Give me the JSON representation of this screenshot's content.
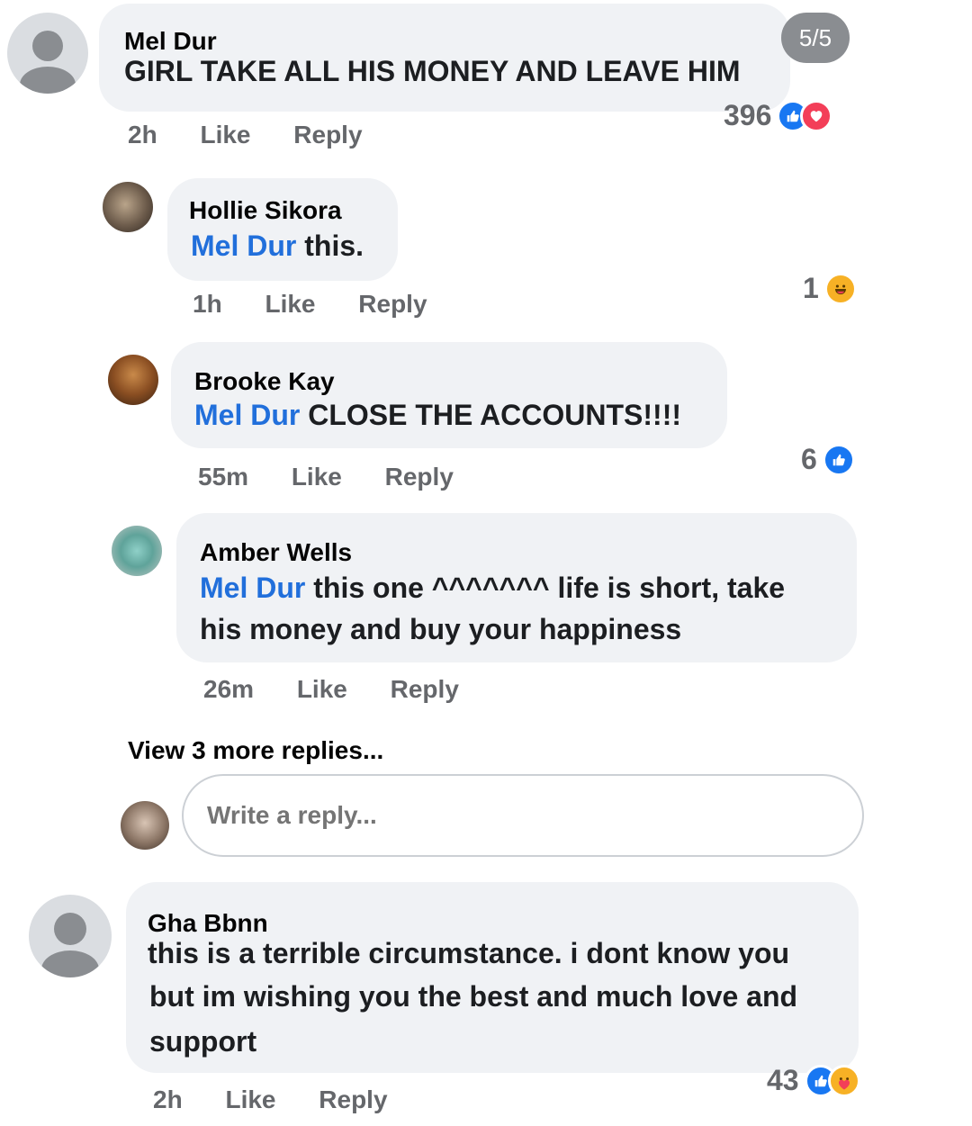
{
  "pager": "5/5",
  "comments": [
    {
      "author": "Mel Dur",
      "text": "GIRL TAKE ALL HIS MONEY AND LEAVE HIM",
      "time": "2h",
      "like": "Like",
      "reply": "Reply",
      "reactions_count": "396",
      "reactions": [
        "like-icon",
        "love-icon"
      ]
    },
    {
      "author": "Hollie Sikora",
      "mention": "Mel Dur",
      "text": " this.",
      "time": "1h",
      "like": "Like",
      "reply": "Reply",
      "reactions_count": "1",
      "reactions": [
        "haha-icon"
      ]
    },
    {
      "author": "Brooke Kay",
      "mention": "Mel Dur",
      "text": " CLOSE THE ACCOUNTS!!!!",
      "time": "55m",
      "like": "Like",
      "reply": "Reply",
      "reactions_count": "6",
      "reactions": [
        "like-icon"
      ]
    },
    {
      "author": "Amber Wells",
      "mention": "Mel Dur",
      "text_line1": " this one ^^^^^^^ life is short, take",
      "text_line2": "his money and buy your happiness",
      "time": "26m",
      "like": "Like",
      "reply": "Reply"
    },
    {
      "author": "Gha Bbnn",
      "text_line1": "this is a terrible circumstance. i dont know you",
      "text_line2": "but im wishing you the best and much love and",
      "text_line3": "support",
      "time": "2h",
      "like": "Like",
      "reply": "Reply",
      "reactions_count": "43",
      "reactions": [
        "like-icon",
        "care-icon"
      ]
    }
  ],
  "view_more": "View 3 more replies...",
  "reply_input": {
    "placeholder": "Write a reply..."
  },
  "colors": {
    "mention": "#216fdb",
    "bubble": "#f0f2f5",
    "like": "#1877f2",
    "love": "#f33e58",
    "haha": "#f7b125"
  }
}
